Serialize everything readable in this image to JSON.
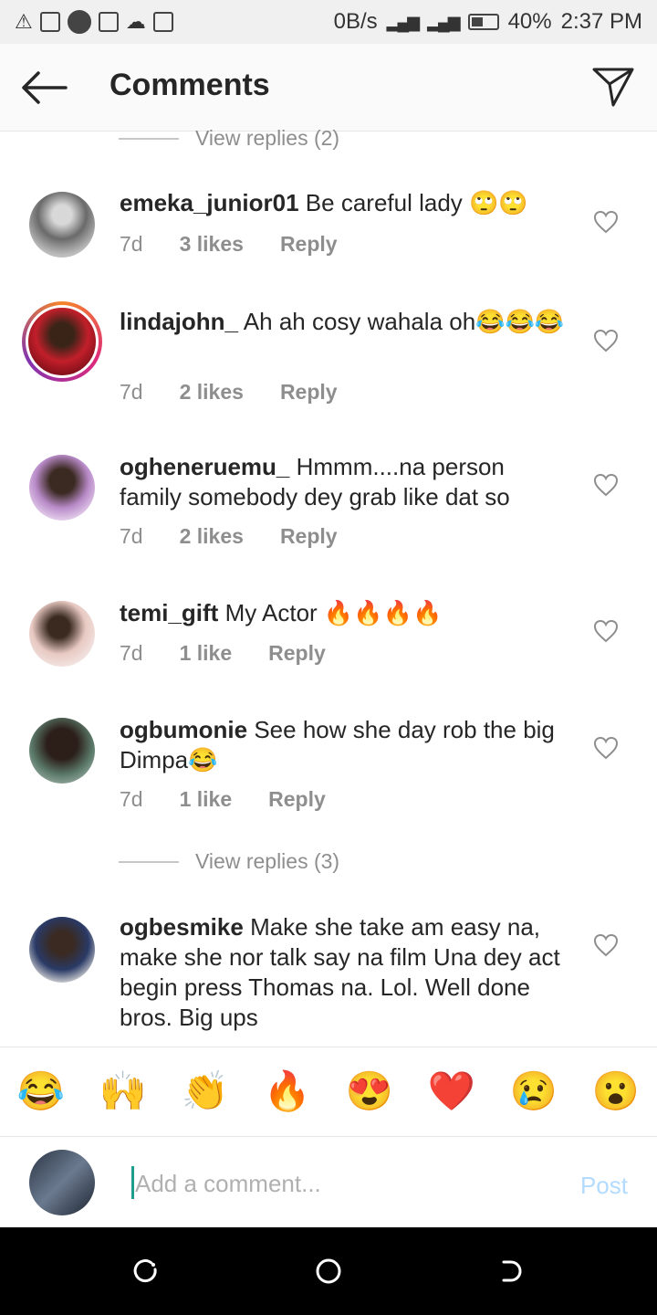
{
  "status": {
    "network_speed": "0B/s",
    "battery": "40%",
    "time": "2:37 PM"
  },
  "header": {
    "title": "Comments"
  },
  "view_replies": [
    "View replies (2)",
    "View replies (3)"
  ],
  "comments": [
    {
      "user": "emeka_junior01",
      "text": "Be careful lady 🙄🙄",
      "time": "7d",
      "likes": "3 likes",
      "reply": "Reply"
    },
    {
      "user": "lindajohn_",
      "text": "Ah ah cosy wahala oh😂😂😂",
      "time": "7d",
      "likes": "2 likes",
      "reply": "Reply"
    },
    {
      "user": "ogheneruemu_",
      "text": "Hmmm....na person family somebody dey grab like dat so",
      "time": "7d",
      "likes": "2 likes",
      "reply": "Reply"
    },
    {
      "user": "temi_gift",
      "text": "My Actor 🔥🔥🔥🔥",
      "time": "7d",
      "likes": "1 like",
      "reply": "Reply"
    },
    {
      "user": "ogbumonie",
      "text": "See how she day rob the big Dimpa😂",
      "time": "7d",
      "likes": "1 like",
      "reply": "Reply"
    },
    {
      "user": "ogbesmike",
      "text": "Make she take am easy na, make she nor talk say na film Una dey act begin press Thomas na. Lol. Well done bros. Big ups"
    }
  ],
  "emojis": [
    "😂",
    "🙌",
    "👏",
    "🔥",
    "😍",
    "❤️",
    "😢",
    "😮"
  ],
  "composer": {
    "placeholder": "Add a comment...",
    "post_label": "Post"
  }
}
